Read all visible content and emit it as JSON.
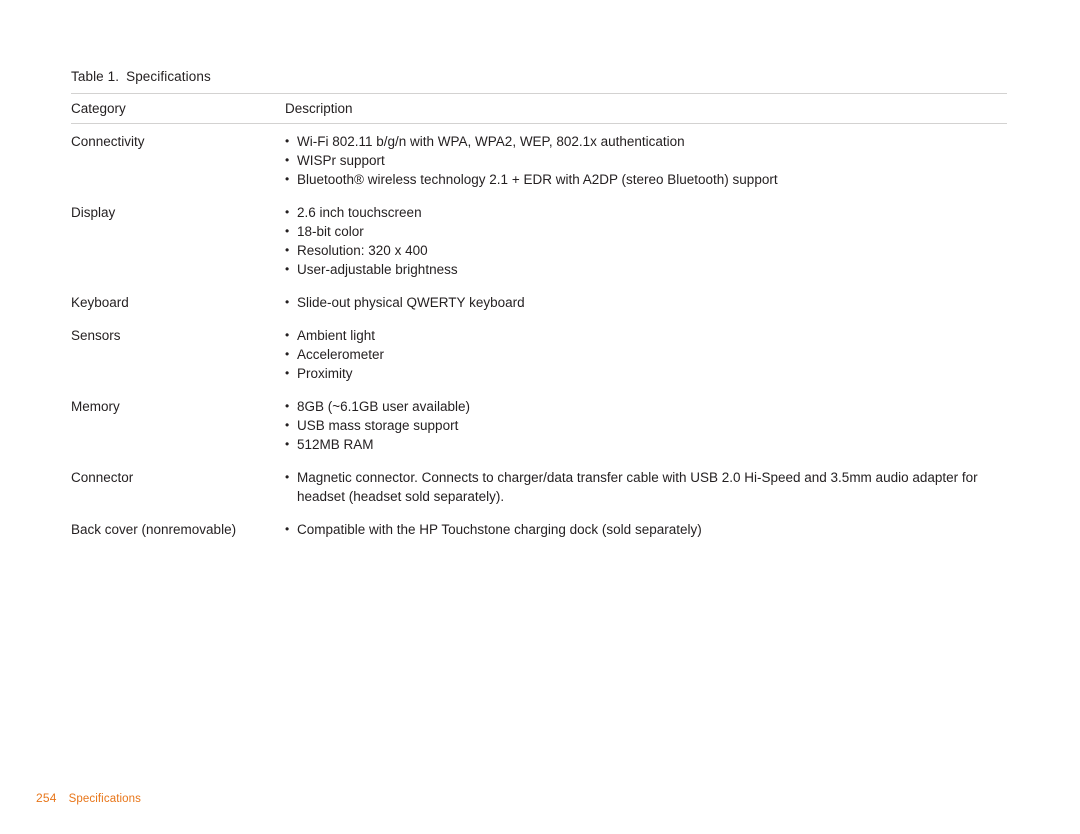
{
  "caption": {
    "number": "Table 1.",
    "title": "Specifications"
  },
  "table": {
    "headers": {
      "category": "Category",
      "description": "Description"
    },
    "rows": [
      {
        "category": "Connectivity",
        "items": [
          "Wi-Fi 802.11 b/g/n with WPA, WPA2, WEP, 802.1x authentication",
          "WISPr support",
          "Bluetooth® wireless technology 2.1 + EDR with A2DP (stereo Bluetooth) support"
        ]
      },
      {
        "category": "Display",
        "items": [
          "2.6 inch touchscreen",
          "18-bit color",
          "Resolution: 320 x 400",
          "User-adjustable brightness"
        ]
      },
      {
        "category": "Keyboard",
        "items": [
          "Slide-out physical QWERTY keyboard"
        ]
      },
      {
        "category": "Sensors",
        "items": [
          "Ambient light",
          "Accelerometer",
          "Proximity"
        ]
      },
      {
        "category": "Memory",
        "items": [
          "8GB (~6.1GB user available)",
          "USB mass storage support",
          "512MB RAM"
        ]
      },
      {
        "category": "Connector",
        "items": [
          "Magnetic connector. Connects to charger/data transfer cable with USB 2.0 Hi-Speed and 3.5mm audio adapter for headset (headset sold separately)."
        ]
      },
      {
        "category": "Back cover (nonremovable)",
        "items": [
          "Compatible with the HP Touchstone charging dock (sold separately)"
        ]
      }
    ]
  },
  "footer": {
    "page_number": "254",
    "label": "Specifications",
    "accent_color": "#e8761a"
  }
}
